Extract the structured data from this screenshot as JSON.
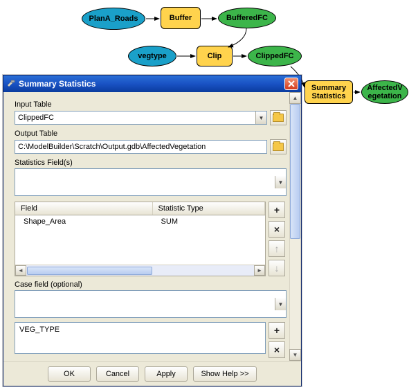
{
  "diagram": {
    "planA": "PlanA_Roads",
    "buffer": "Buffer",
    "bufferedFC": "BufferedFC",
    "vegtype": "vegtype",
    "clip": "Clip",
    "clippedFC": "ClippedFC",
    "sumstats": "Summary\nStatistics",
    "affected": "AffectedV\negetation"
  },
  "dialog": {
    "title": "Summary Statistics",
    "inputTable": {
      "label": "Input Table",
      "value": "ClippedFC"
    },
    "outputTable": {
      "label": "Output Table",
      "value": "C:\\ModelBuilder\\Scratch\\Output.gdb\\AffectedVegetation"
    },
    "statsFields": {
      "label": "Statistics Field(s)"
    },
    "grid": {
      "headers": {
        "field": "Field",
        "stat": "Statistic Type"
      },
      "rows": [
        {
          "field": "Shape_Area",
          "stat": "SUM"
        }
      ]
    },
    "caseField": {
      "label": "Case field (optional)"
    },
    "caseList": {
      "items": [
        "VEG_TYPE"
      ]
    },
    "buttons": {
      "ok": "OK",
      "cancel": "Cancel",
      "apply": "Apply",
      "help": "Show Help >>"
    }
  }
}
